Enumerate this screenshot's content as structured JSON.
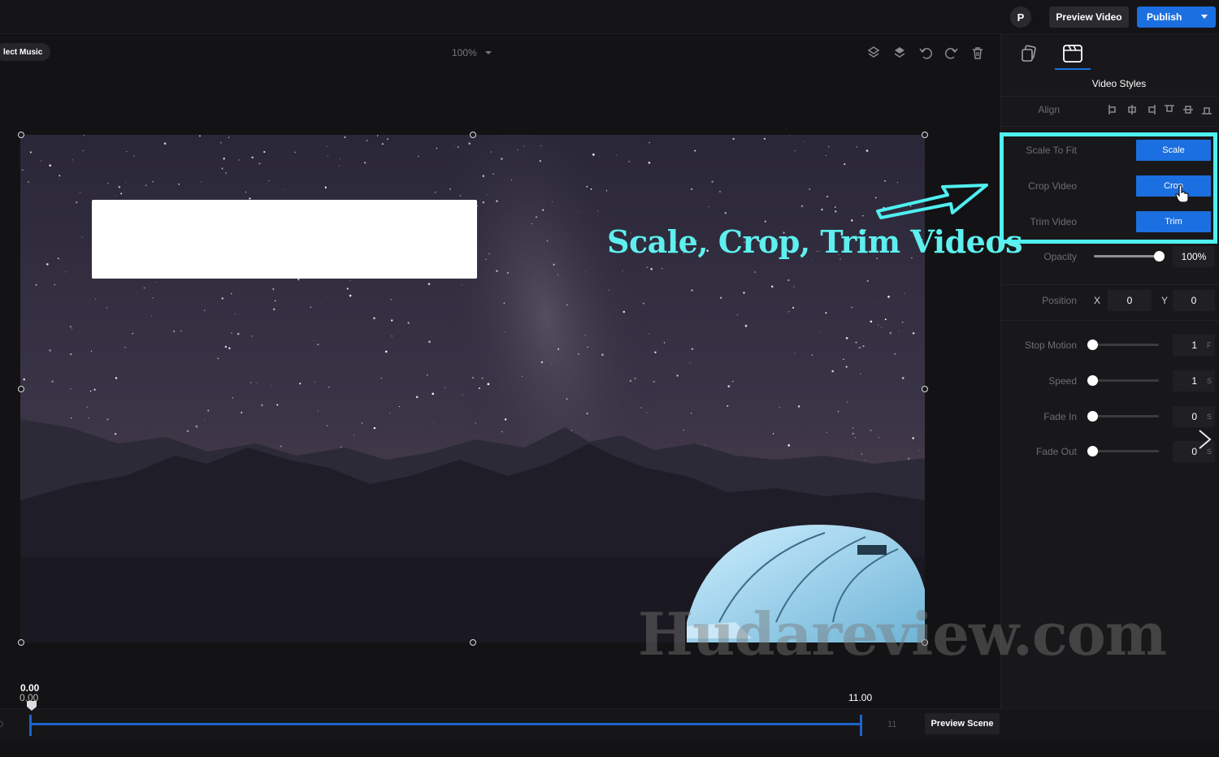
{
  "topbar": {
    "avatar_initial": "P",
    "preview_label": "Preview Video",
    "publish_label": "Publish"
  },
  "canvas": {
    "select_music_label": "lect Music",
    "zoom_level": "100%",
    "tool_icons": [
      "layer-up-icon",
      "layer-down-icon",
      "undo-icon",
      "redo-icon",
      "trash-icon"
    ]
  },
  "panel": {
    "tabs": [
      "layers-icon",
      "video-styles-icon"
    ],
    "title": "Video Styles",
    "align_label": "Align",
    "scale_label": "Scale To Fit",
    "scale_button": "Scale",
    "crop_label": "Crop Video",
    "crop_button": "Crop",
    "trim_label": "Trim Video",
    "trim_button": "Trim",
    "opacity_label": "Opacity",
    "opacity_value": "100%",
    "opacity_level": 1.0,
    "position_label": "Position",
    "x_label": "X",
    "x_value": "0",
    "y_label": "Y",
    "y_value": "0",
    "stop_motion_label": "Stop Motion",
    "stop_motion_value": "1",
    "stop_motion_unit": "F",
    "speed_label": "Speed",
    "speed_value": "1",
    "speed_unit": "S",
    "fade_in_label": "Fade In",
    "fade_in_value": "0",
    "fade_in_unit": "S",
    "fade_out_label": "Fade Out",
    "fade_out_value": "0",
    "fade_out_unit": "S"
  },
  "annotation": {
    "caption": "Scale, Crop, Trim Videos",
    "watermark": "Hudareview.com",
    "highlight_color": "#4ff0f0"
  },
  "timeline": {
    "start_top": "0.00",
    "start_bottom": "0.00",
    "end": "11.00",
    "left_count": "0",
    "count": "11",
    "preview_scene_label": "Preview Scene"
  },
  "colors": {
    "accent": "#1b6fe0",
    "background": "#131315"
  }
}
